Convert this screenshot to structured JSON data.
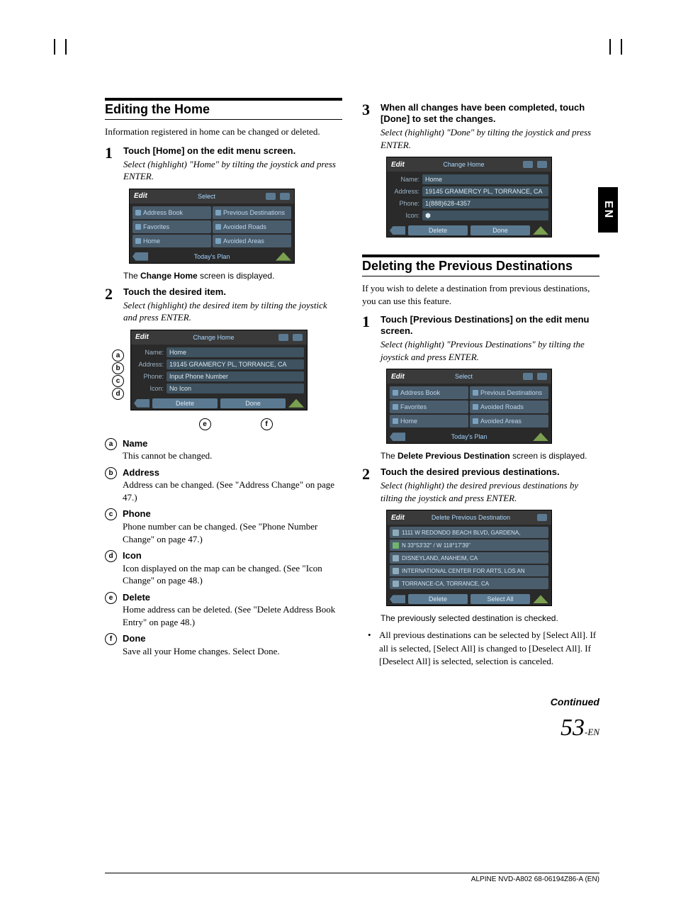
{
  "page": {
    "lang_tab": "EN",
    "continued": "Continued",
    "page_num": "53",
    "page_suffix": "-EN",
    "footer": "ALPINE NVD-A802 68-06194Z86-A (EN)"
  },
  "left": {
    "heading": "Editing the Home",
    "intro": "Information registered in home can be changed or deleted.",
    "step1": {
      "num": "1",
      "title_a": "Touch ",
      "bracket": "[Home]",
      "title_b": " on the edit menu screen.",
      "em": "Select (highlight) \"Home\" by tilting the joystick and press ENTER."
    },
    "dev1": {
      "title": "Edit",
      "sub": "Select",
      "opts": [
        "Address Book",
        "Previous Destinations",
        "Favorites",
        "Avoided Roads",
        "Home",
        "Avoided Areas"
      ],
      "plan": "Today's Plan"
    },
    "note1_a": "The ",
    "note1_b": "Change Home",
    "note1_c": " screen is displayed.",
    "step2": {
      "num": "2",
      "title": "Touch the desired item.",
      "em": "Select (highlight) the desired item by tilting the joystick and press ENTER."
    },
    "dev2": {
      "title": "Edit",
      "sub": "Change Home",
      "rows": [
        [
          "Name:",
          "Home"
        ],
        [
          "Address:",
          "19145 GRAMERCY PL, TORRANCE, CA"
        ],
        [
          "Phone:",
          "Input Phone Number"
        ],
        [
          "Icon:",
          "No Icon"
        ]
      ],
      "btns": [
        "Delete",
        "Done"
      ]
    },
    "side_labels": [
      "a",
      "b",
      "c",
      "d"
    ],
    "below_labels": [
      "e",
      "f"
    ],
    "defs": [
      {
        "k": "a",
        "t": "Name",
        "d": "This cannot be changed."
      },
      {
        "k": "b",
        "t": "Address",
        "d": "Address can be changed. (See \"Address Change\" on page 47.)"
      },
      {
        "k": "c",
        "t": "Phone",
        "d": "Phone number can be changed. (See  \"Phone Number Change\" on page 47.)"
      },
      {
        "k": "d",
        "t": "Icon",
        "d": "Icon displayed on the map can be changed. (See \"Icon Change\" on page 48.)"
      },
      {
        "k": "e",
        "t": "Delete",
        "d": "Home address can be deleted. (See \"Delete Address Book Entry\" on page 48.)"
      },
      {
        "k": "f",
        "t": "Done",
        "d": "Save all your Home changes. Select Done."
      }
    ]
  },
  "right": {
    "step3": {
      "num": "3",
      "title_a": "When all changes have been completed, touch ",
      "bracket": "[Done]",
      "title_b": " to set the changes.",
      "em": "Select (highlight) \"Done\" by tilting the joystick and press ENTER."
    },
    "dev3": {
      "title": "Edit",
      "sub": "Change Home",
      "rows": [
        [
          "Name:",
          "Home"
        ],
        [
          "Address:",
          "19145 GRAMERCY PL, TORRANCE, CA"
        ],
        [
          "Phone:",
          "1(888)628-4357"
        ],
        [
          "Icon:",
          "⬢"
        ]
      ],
      "btns": [
        "Delete",
        "Done"
      ]
    },
    "heading": "Deleting the Previous Destinations",
    "intro": "If you wish to delete a destination from previous destinations, you can use this feature.",
    "d_step1": {
      "num": "1",
      "title_a": "Touch ",
      "bracket": "[Previous Destinations]",
      "title_b": " on the edit menu screen.",
      "em": "Select (highlight) \"Previous Destinations\" by tilting the joystick and press ENTER."
    },
    "dev4": {
      "title": "Edit",
      "sub": "Select",
      "opts": [
        "Address Book",
        "Previous Destinations",
        "Favorites",
        "Avoided Roads",
        "Home",
        "Avoided Areas"
      ],
      "plan": "Today's Plan"
    },
    "note2_a": "The ",
    "note2_b": "Delete Previous Destination",
    "note2_c": " screen is displayed.",
    "d_step2": {
      "num": "2",
      "title": "Touch the desired previous destinations.",
      "em": "Select (highlight) the desired previous destinations by tilting the joystick and press ENTER."
    },
    "dev5": {
      "title": "Edit",
      "sub": "Delete Previous Destination",
      "items": [
        "1111 W REDONDO BEACH BLVD, GARDENA,",
        "N 33°53'32\" / W 118°17'39\"",
        "DISNEYLAND, ANAHEIM, CA",
        "INTERNATIONAL CENTER FOR ARTS, LOS AN",
        "TORRANCE-CA, TORRANCE, CA"
      ],
      "btns": [
        "Delete",
        "Select All"
      ]
    },
    "note3": "The previously selected destination is checked.",
    "bullet": "All previous destinations can be selected by [Select All]. If all is selected, [Select All] is changed to [Deselect All]. If [Deselect All] is selected, selection is canceled."
  }
}
